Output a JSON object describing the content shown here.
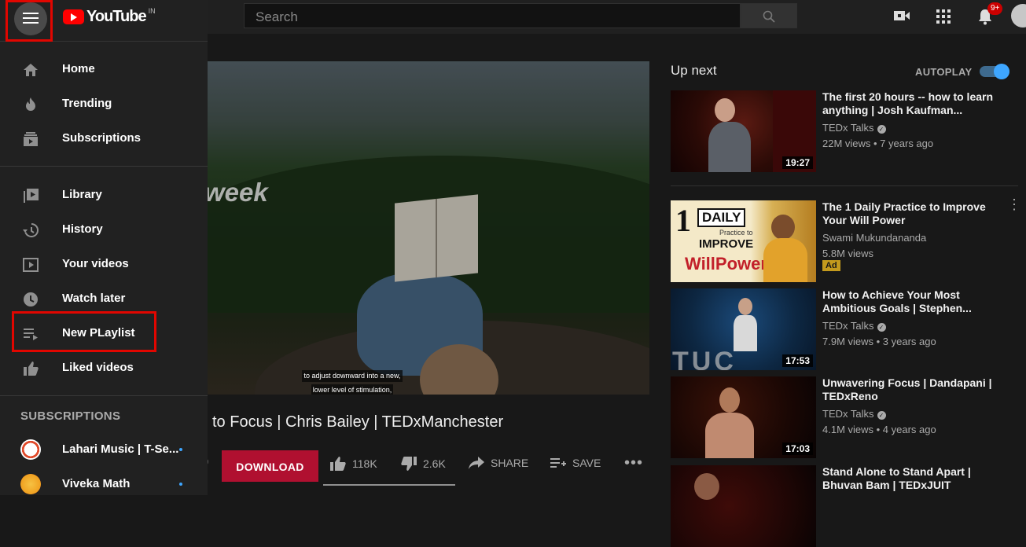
{
  "header": {
    "logo_text": "YouTube",
    "logo_country": "IN",
    "search_placeholder": "Search",
    "notification_count": "9+"
  },
  "sidebar": {
    "primary": [
      {
        "label": "Home",
        "icon": "home-icon"
      },
      {
        "label": "Trending",
        "icon": "fire-icon"
      },
      {
        "label": "Subscriptions",
        "icon": "subscriptions-icon"
      }
    ],
    "library": [
      {
        "label": "Library",
        "icon": "library-icon"
      },
      {
        "label": "History",
        "icon": "history-icon"
      },
      {
        "label": "Your videos",
        "icon": "your-videos-icon"
      },
      {
        "label": "Watch later",
        "icon": "clock-icon"
      },
      {
        "label": "New PLaylist",
        "icon": "playlist-add-icon",
        "highlighted": true
      },
      {
        "label": "Liked videos",
        "icon": "thumbs-up-icon"
      }
    ],
    "subscriptions_heading": "SUBSCRIPTIONS",
    "subscriptions": [
      {
        "label": "Lahari Music | T-Se...",
        "new_content": true
      },
      {
        "label": "Viveka Math",
        "new_content": true
      }
    ]
  },
  "player": {
    "overlay_word": "week",
    "caption_line1": "to adjust downward into a new,",
    "caption_line2": "lower level of stimulation,"
  },
  "video": {
    "title_cut": "",
    "title_visible": "to Focus | Chris Bailey | TEDxManchester",
    "views_fragment": "9",
    "download_label": "DOWNLOAD",
    "likes": "118K",
    "dislikes": "2.6K",
    "share_label": "SHARE",
    "save_label": "SAVE"
  },
  "upnext": {
    "heading": "Up next",
    "autoplay_label": "AUTOPLAY",
    "autoplay_on": true,
    "items": [
      {
        "title": "The first 20 hours -- how to learn anything | Josh Kaufman...",
        "channel": "TEDx Talks",
        "verified": true,
        "meta": "22M views • 7 years ago",
        "duration": "19:27"
      },
      {
        "title": "The 1 Daily Practice to Improve Your Will Power",
        "channel": "Swami Mukundananda",
        "verified": false,
        "meta": "5.8M views",
        "badge": "Ad",
        "thumb_text_1": "1",
        "thumb_text_2": "DAILY",
        "thumb_text_3": "Practice to",
        "thumb_text_4": "IMPROVE",
        "thumb_text_5": "WillPower"
      },
      {
        "title": "How to Achieve Your Most Ambitious Goals | Stephen...",
        "channel": "TEDx Talks",
        "verified": true,
        "meta": "7.9M views • 3 years ago",
        "duration": "17:53"
      },
      {
        "title": "Unwavering Focus | Dandapani | TEDxReno",
        "channel": "TEDx Talks",
        "verified": true,
        "meta": "4.1M views • 4 years ago",
        "duration": "17:03"
      },
      {
        "title": "Stand Alone to Stand Apart | Bhuvan Bam | TEDxJUIT",
        "channel": "",
        "meta": ""
      }
    ]
  },
  "colors": {
    "background": "#181818",
    "sidebar": "#212121",
    "brand_red": "#ff0000",
    "download_button": "#b01030",
    "highlight_box": "#e10600",
    "accent_blue": "#3ea6ff"
  }
}
